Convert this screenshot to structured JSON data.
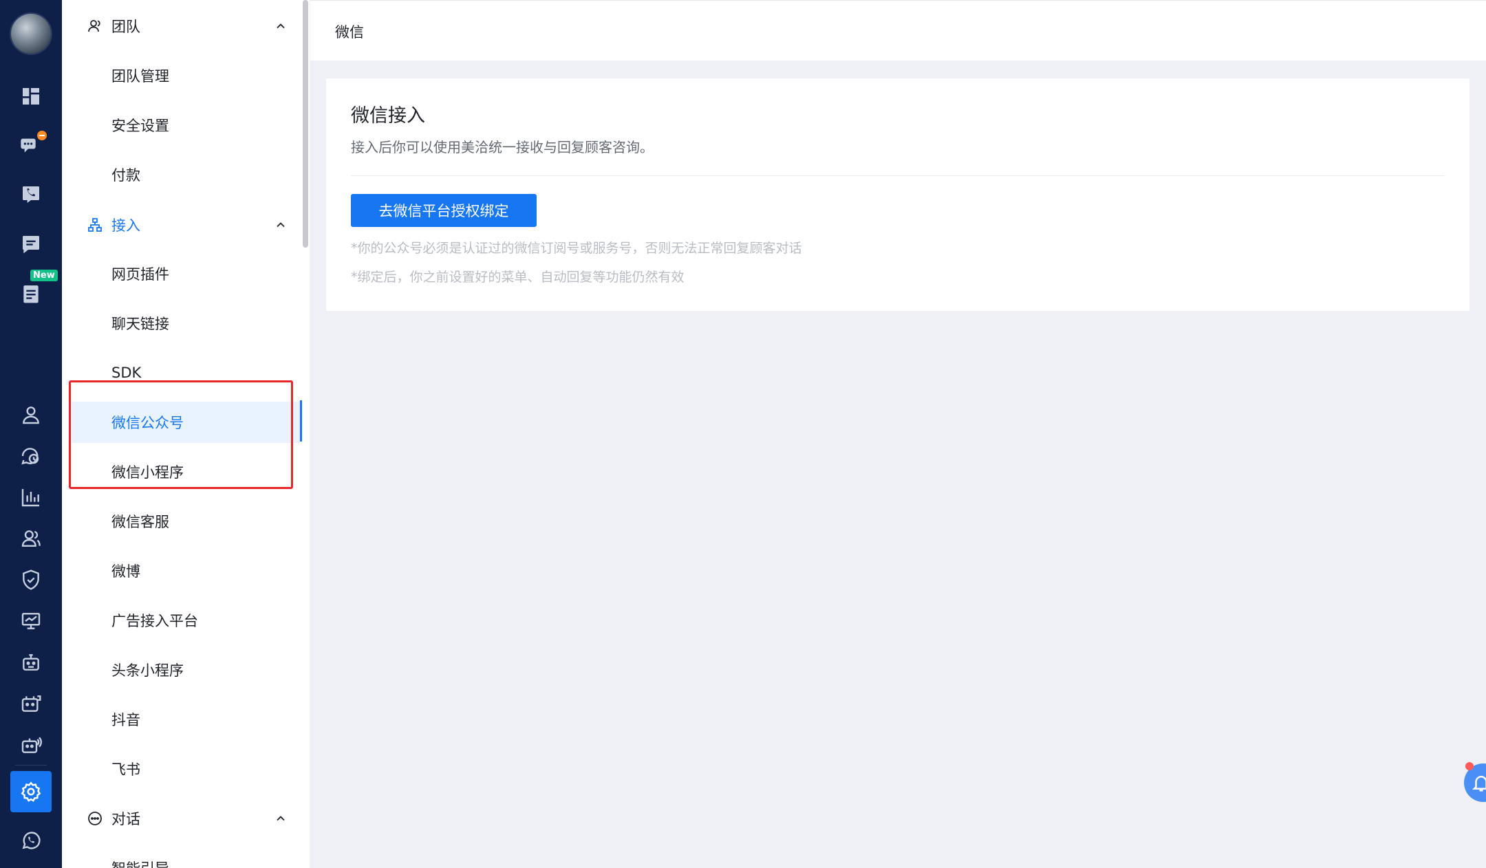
{
  "rail": {
    "avatar": "user-avatar",
    "icons": [
      "dashboard-icon",
      "chat-bubbles-icon",
      "phone-icon",
      "message-icon",
      "tickets-icon",
      "contacts-icon",
      "history-icon",
      "analytics-icon",
      "team-icon",
      "security-icon",
      "monitor-icon",
      "robot-icon",
      "robot-chat-icon",
      "robot-voice-icon",
      "settings-icon",
      "whatsapp-icon"
    ],
    "new_badge": "New",
    "active": "settings-icon",
    "colors": {
      "background": "#0f2048",
      "active": "#1777f2",
      "badge_orange": "#ff8a1f",
      "badge_green": "#13c28a"
    }
  },
  "menu": {
    "groups": {
      "team": {
        "label": "团队",
        "icon": "team-icon",
        "expanded": true
      },
      "integration": {
        "label": "接入",
        "icon": "sitemap-icon",
        "expanded": true
      },
      "dialog": {
        "label": "对话",
        "icon": "chat-dots-icon",
        "expanded": true
      }
    },
    "team_items": [
      "团队管理",
      "安全设置",
      "付款"
    ],
    "integration_items": [
      "网页插件",
      "聊天链接",
      "SDK",
      "微信公众号",
      "微信小程序",
      "微信客服",
      "微博",
      "广告接入平台",
      "头条小程序",
      "抖音",
      "飞书"
    ],
    "dialog_items": [
      "智能引导"
    ],
    "selected": "微信公众号"
  },
  "header": {
    "title": "微信"
  },
  "card": {
    "title": "微信接入",
    "description": "接入后你可以使用美洽统一接收与回复顾客咨询。",
    "button_label": "去微信平台授权绑定",
    "notes": [
      "*你的公众号必须是认证过的微信订阅号或服务号，否则无法正常回复顾客对话",
      "*绑定后，你之前设置好的菜单、自动回复等功能仍然有效"
    ]
  },
  "colors": {
    "accent": "#1777f2",
    "highlight_border": "#e8252a",
    "page_background": "#eef0f5"
  }
}
